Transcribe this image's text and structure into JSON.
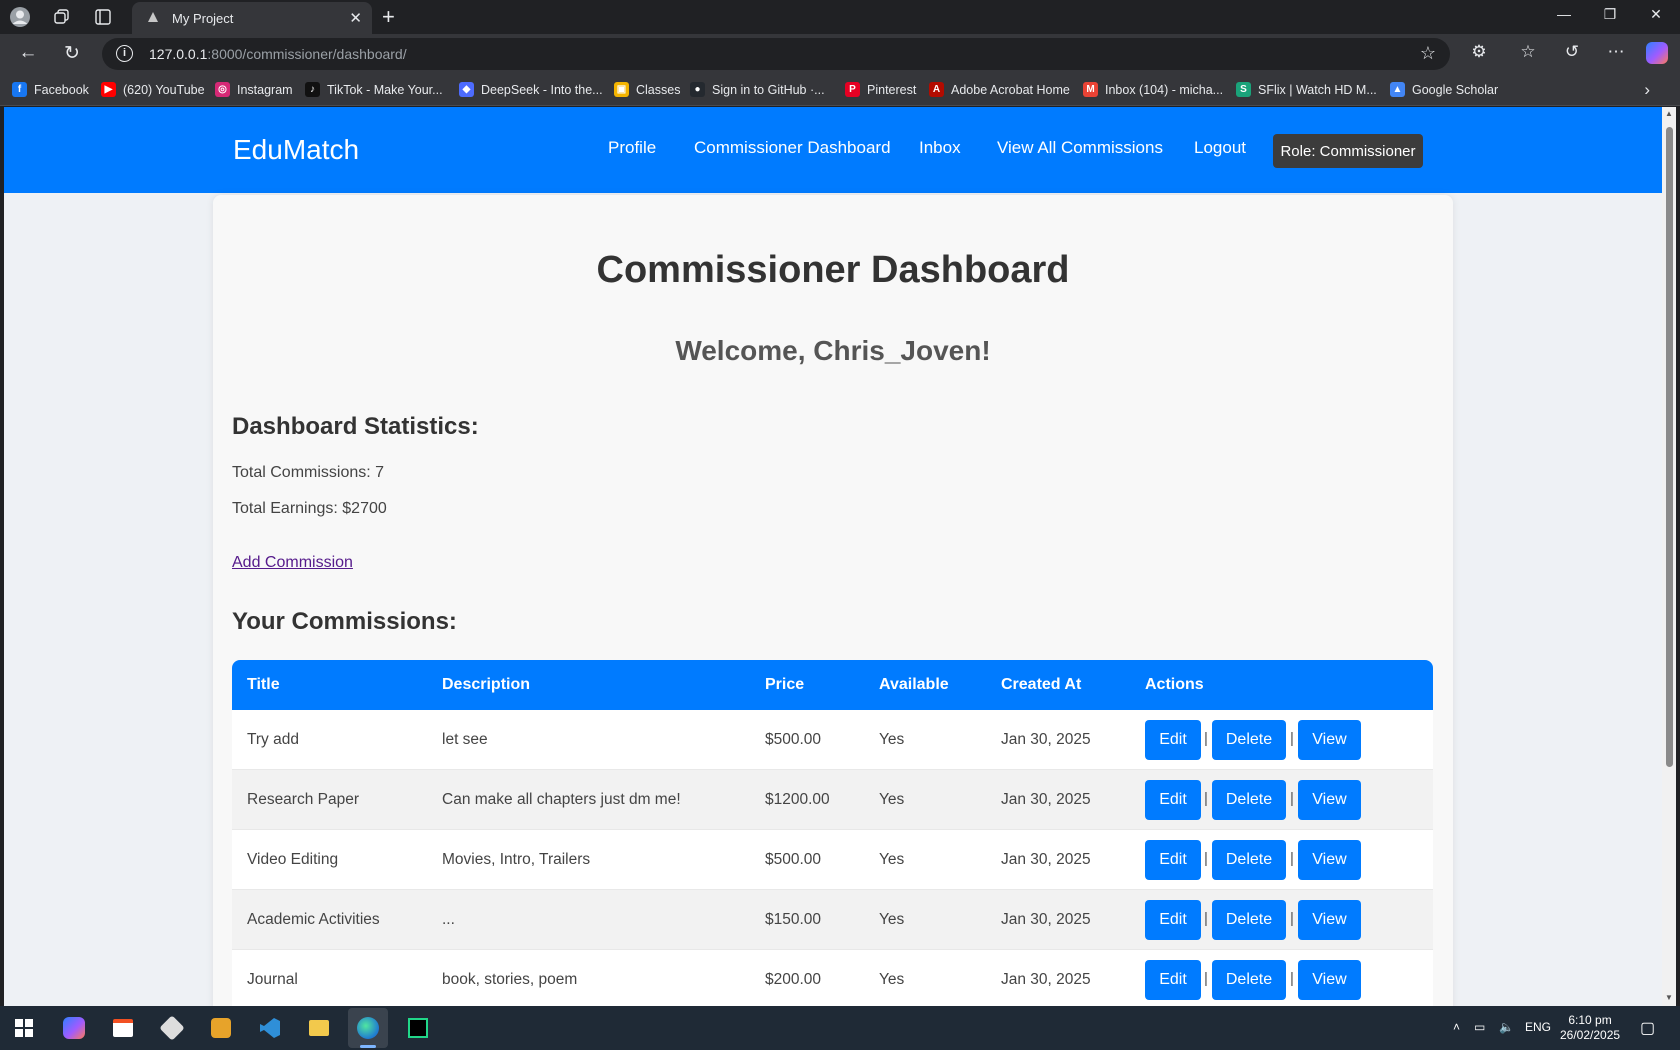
{
  "browser": {
    "tab_title": "My Project",
    "url_host": "127.0.0.1",
    "url_rest": ":8000/commissioner/dashboard/",
    "bookmarks": [
      {
        "label": "Facebook",
        "icon": "facebook-icon",
        "color": "#1877f2",
        "glyph": "f"
      },
      {
        "label": "(620) YouTube",
        "icon": "youtube-icon",
        "color": "#ff0000",
        "glyph": "▶"
      },
      {
        "label": "Instagram",
        "icon": "instagram-icon",
        "color": "#d62976",
        "glyph": "◎"
      },
      {
        "label": "TikTok - Make Your...",
        "icon": "tiktok-icon",
        "color": "#111111",
        "glyph": "♪"
      },
      {
        "label": "DeepSeek - Into the...",
        "icon": "deepseek-icon",
        "color": "#4d6bfe",
        "glyph": "◆"
      },
      {
        "label": "Classes",
        "icon": "classroom-icon",
        "color": "#f4b400",
        "glyph": "▣"
      },
      {
        "label": "Sign in to GitHub ·...",
        "icon": "github-icon",
        "color": "#24292f",
        "glyph": "●"
      },
      {
        "label": "Pinterest",
        "icon": "pinterest-icon",
        "color": "#e60023",
        "glyph": "P"
      },
      {
        "label": "Adobe Acrobat Home",
        "icon": "acrobat-icon",
        "color": "#b30b00",
        "glyph": "A"
      },
      {
        "label": "Inbox (104) - micha...",
        "icon": "gmail-icon",
        "color": "#ea4335",
        "glyph": "M"
      },
      {
        "label": "SFlix | Watch HD M...",
        "icon": "sflix-icon",
        "color": "#1aa37a",
        "glyph": "S"
      },
      {
        "label": "Google Scholar",
        "icon": "scholar-icon",
        "color": "#4285f4",
        "glyph": "▲"
      }
    ]
  },
  "nav": {
    "brand": "EduMatch",
    "links": [
      "Profile",
      "Commissioner Dashboard",
      "Inbox",
      "View All Commissions",
      "Logout"
    ],
    "role": "Role: Commissioner"
  },
  "main": {
    "title": "Commissioner Dashboard",
    "welcome": "Welcome, Chris_Joven!",
    "stats_heading": "Dashboard Statistics:",
    "total_commissions": "Total Commissions: 7",
    "total_earnings": "Total Earnings: $2700",
    "add_link": "Add Commission",
    "commissions_heading": "Your Commissions:"
  },
  "table": {
    "headers": [
      "Title",
      "Description",
      "Price",
      "Available",
      "Created At",
      "Actions"
    ],
    "rows": [
      {
        "title": "Try add",
        "description": "let see",
        "price": "$500.00",
        "available": "Yes",
        "created": "Jan 30, 2025"
      },
      {
        "title": "Research Paper",
        "description": "Can make all chapters just dm me!",
        "price": "$1200.00",
        "available": "Yes",
        "created": "Jan 30, 2025"
      },
      {
        "title": "Video Editing",
        "description": "Movies, Intro, Trailers",
        "price": "$500.00",
        "available": "Yes",
        "created": "Jan 30, 2025"
      },
      {
        "title": "Academic Activities",
        "description": "...",
        "price": "$150.00",
        "available": "Yes",
        "created": "Jan 30, 2025"
      },
      {
        "title": "Journal",
        "description": "book, stories, poem",
        "price": "$200.00",
        "available": "Yes",
        "created": "Jan 30, 2025"
      }
    ],
    "actions": {
      "edit": "Edit",
      "delete": "Delete",
      "view": "View",
      "separator": "|"
    }
  },
  "taskbar": {
    "lang": "ENG",
    "time": "6:10 pm",
    "date": "26/02/2025"
  },
  "colors": {
    "accent": "#007bff",
    "role_badge": "#3c3c3c"
  }
}
